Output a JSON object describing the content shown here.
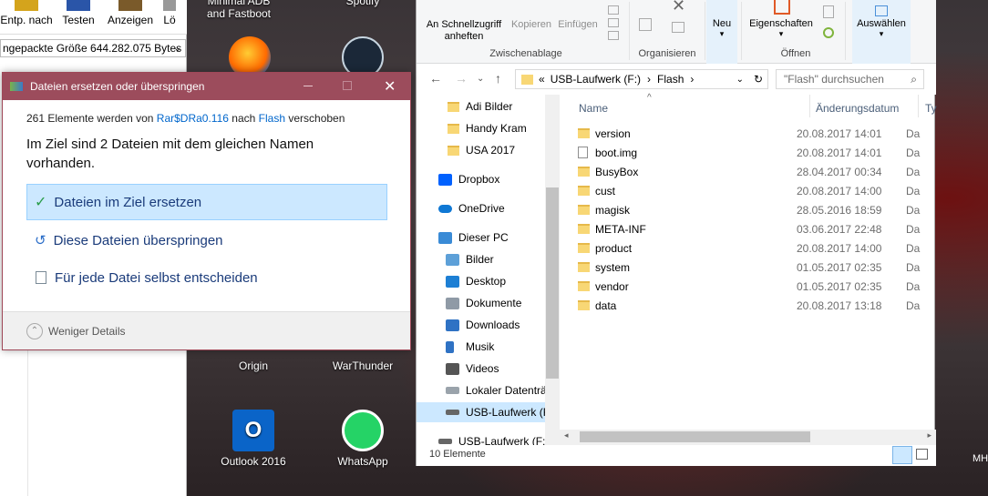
{
  "left_app": {
    "buttons": [
      {
        "label": "Entp. nach",
        "icon": "extract-icon"
      },
      {
        "label": "Testen",
        "icon": "test-icon"
      },
      {
        "label": "Anzeigen",
        "icon": "view-icon"
      },
      {
        "label": "Lö",
        "icon": "delete-icon"
      }
    ],
    "info": "ngepackte Größe 644.282.075 Bytes"
  },
  "desktop": {
    "icons": [
      {
        "label": "Minimal ADB and Fastboot",
        "icon": "adb-icon"
      },
      {
        "label": "Spotify",
        "icon": "spotify-icon"
      },
      {
        "label": "Origin",
        "icon": "origin-icon"
      },
      {
        "label": "WarThunder",
        "icon": "warthunder-icon"
      },
      {
        "label": "Outlook 2016",
        "icon": "outlook-icon"
      },
      {
        "label": "WhatsApp",
        "icon": "whatsapp-icon"
      },
      {
        "label": "Firefox",
        "icon": "firefox-icon"
      },
      {
        "label": "Steam",
        "icon": "steam-icon"
      }
    ],
    "corner_text": "MH"
  },
  "explorer": {
    "ribbon": {
      "quickaccess": "An Schnellzugriff anheften",
      "copy": "Kopieren",
      "paste": "Einfügen",
      "group_clipboard": "Zwischenablage",
      "group_organize": "Organisieren",
      "new": "Neu",
      "properties": "Eigenschaften",
      "group_open": "Öffnen",
      "select": "Auswählen"
    },
    "address": {
      "prefix": "«",
      "segments": [
        "USB-Laufwerk (F:)",
        "Flash"
      ],
      "sep": "›",
      "search_placeholder": "\"Flash\" durchsuchen"
    },
    "nav": [
      {
        "label": "Adi Bilder",
        "icon": "folder-icon"
      },
      {
        "label": "Handy Kram",
        "icon": "folder-icon"
      },
      {
        "label": "USA 2017",
        "icon": "folder-icon"
      },
      {
        "label": "Dropbox",
        "icon": "dropbox-icon"
      },
      {
        "label": "OneDrive",
        "icon": "onedrive-icon"
      },
      {
        "label": "Dieser PC",
        "icon": "pc-icon"
      },
      {
        "label": "Bilder",
        "icon": "pictures-icon"
      },
      {
        "label": "Desktop",
        "icon": "desktop-icon"
      },
      {
        "label": "Dokumente",
        "icon": "documents-icon"
      },
      {
        "label": "Downloads",
        "icon": "downloads-icon"
      },
      {
        "label": "Musik",
        "icon": "music-icon"
      },
      {
        "label": "Videos",
        "icon": "videos-icon"
      },
      {
        "label": "Lokaler Datenträ",
        "icon": "drive-icon"
      },
      {
        "label": "USB-Laufwerk (F",
        "icon": "usb-drive-icon"
      },
      {
        "label": "USB-Laufwerk (F:)",
        "icon": "usb-drive-icon"
      }
    ],
    "columns": {
      "name": "Name",
      "date": "Änderungsdatum",
      "type": "Ty"
    },
    "files": [
      {
        "name": "version",
        "date": "20.08.2017 14:01",
        "type": "Da",
        "kind": "folder"
      },
      {
        "name": "boot.img",
        "date": "20.08.2017 14:01",
        "type": "Da",
        "kind": "file"
      },
      {
        "name": "BusyBox",
        "date": "28.04.2017 00:34",
        "type": "Da",
        "kind": "folder"
      },
      {
        "name": "cust",
        "date": "20.08.2017 14:00",
        "type": "Da",
        "kind": "folder"
      },
      {
        "name": "magisk",
        "date": "28.05.2016 18:59",
        "type": "Da",
        "kind": "folder"
      },
      {
        "name": "META-INF",
        "date": "03.06.2017 22:48",
        "type": "Da",
        "kind": "folder"
      },
      {
        "name": "product",
        "date": "20.08.2017 14:00",
        "type": "Da",
        "kind": "folder"
      },
      {
        "name": "system",
        "date": "01.05.2017 02:35",
        "type": "Da",
        "kind": "folder"
      },
      {
        "name": "vendor",
        "date": "01.05.2017 02:35",
        "type": "Da",
        "kind": "folder"
      },
      {
        "name": "data",
        "date": "20.08.2017 13:18",
        "type": "Da",
        "kind": "folder"
      }
    ],
    "status": "10 Elemente"
  },
  "dialog": {
    "title": "Dateien ersetzen oder überspringen",
    "info_prefix": "261 Elemente werden von",
    "source": "Rar$DRa0.116",
    "info_mid": "nach",
    "target": "Flash",
    "info_suffix": "verschoben",
    "heading": "Im Ziel sind 2 Dateien mit dem gleichen Namen vorhanden.",
    "options": [
      {
        "label": "Dateien im Ziel ersetzen",
        "icon": "checkmark-icon"
      },
      {
        "label": "Diese Dateien überspringen",
        "icon": "skip-icon"
      },
      {
        "label": "Für jede Datei selbst entscheiden",
        "icon": "decide-icon"
      }
    ],
    "footer": "Weniger Details"
  },
  "colors": {
    "dialog_title": "#9c4c5c",
    "accent_link": "#0066cc",
    "selection": "#cce8ff"
  }
}
